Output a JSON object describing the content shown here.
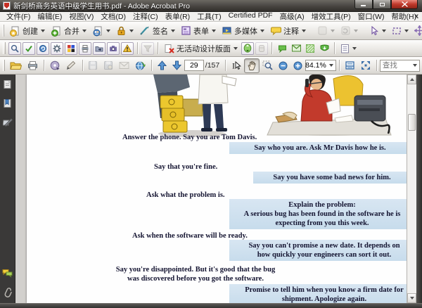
{
  "window": {
    "title": "新剑桥商务英语中级学生用书.pdf - Adobe Acrobat Pro",
    "controls": {
      "minimize": "minimize",
      "maximize": "maximize",
      "close": "close"
    }
  },
  "menu": {
    "items": [
      "文件(F)",
      "编辑(E)",
      "视图(V)",
      "文档(D)",
      "注释(C)",
      "表单(R)",
      "工具(T)",
      "Certified PDF",
      "高级(A)",
      "增效工具(P)",
      "窗口(W)",
      "帮助(H)"
    ],
    "close_doc_label": "x"
  },
  "toolbar1": {
    "create_label": "创建",
    "combine_label": "合并",
    "sign_label": "签名",
    "forms_label": "表单",
    "multimedia_label": "多媒体",
    "comment_label": "注释"
  },
  "toolbar2": {
    "layout_label": "无活动设计版面"
  },
  "toolbar3": {
    "page_current": "29",
    "page_total": "/157",
    "zoom_level": "84.1%",
    "find_placeholder": "查找"
  },
  "colors": {
    "highlight_blue": "#cddfee",
    "titlebar": "#45423e",
    "accent_purple": "#7b5ea7",
    "pitstop_green": "#6abf4b"
  },
  "document": {
    "dialogue": [
      {
        "style": "plain",
        "lines": [
          "Answer the phone. Say you are Tom Davis."
        ]
      },
      {
        "style": "highlight",
        "lines": [
          "Say who you are. Ask Mr Davis how he is."
        ]
      },
      {
        "style": "plain",
        "lines": [
          "Say that you're fine."
        ]
      },
      {
        "style": "highlight",
        "lines": [
          "Say you have some bad news for him."
        ]
      },
      {
        "style": "plain",
        "lines": [
          "Ask what the problem is."
        ]
      },
      {
        "style": "highlight",
        "lines": [
          "Explain the problem:",
          "A serious bug has been found in the software he is",
          "expecting from you this week."
        ]
      },
      {
        "style": "plain",
        "lines": [
          "Ask when the software will be ready."
        ]
      },
      {
        "style": "highlight",
        "lines": [
          "Say you can't promise a new date. It depends on",
          "how quickly your engineers can sort it out."
        ]
      },
      {
        "style": "plain",
        "lines": [
          "Say you're disappointed. But it's good that the bug",
          "was discovered before you got the software."
        ]
      },
      {
        "style": "highlight",
        "lines": [
          "Promise to tell him when you know a firm date for",
          "shipment. Apologize again."
        ]
      }
    ]
  }
}
